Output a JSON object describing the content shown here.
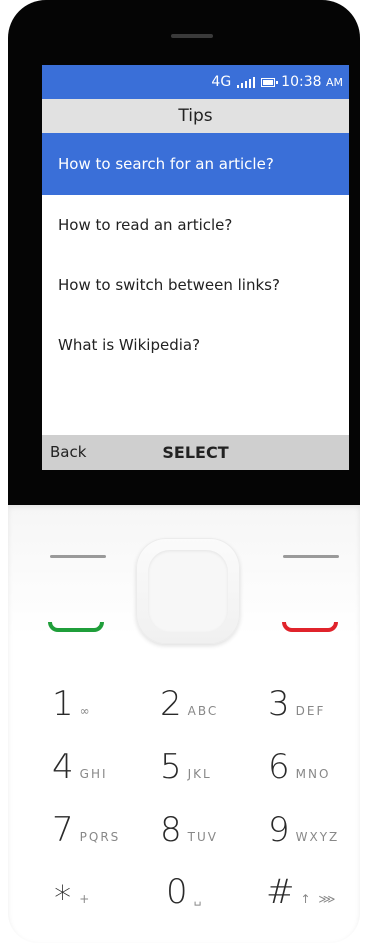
{
  "status": {
    "network": "4G",
    "time": "10:38",
    "ampm": "AM"
  },
  "screen": {
    "title": "Tips",
    "items": [
      {
        "label": "How to search for an article?",
        "selected": true
      },
      {
        "label": "How to read an article?",
        "selected": false
      },
      {
        "label": "How to switch between links?",
        "selected": false
      },
      {
        "label": "What is Wikipedia?",
        "selected": false
      }
    ],
    "softkeys": {
      "left": "Back",
      "center": "SELECT"
    }
  },
  "keypad": [
    {
      "digit": "1",
      "letters": "∞"
    },
    {
      "digit": "2",
      "letters": "ABC"
    },
    {
      "digit": "3",
      "letters": "DEF"
    },
    {
      "digit": "4",
      "letters": "GHI"
    },
    {
      "digit": "5",
      "letters": "JKL"
    },
    {
      "digit": "6",
      "letters": "MNO"
    },
    {
      "digit": "7",
      "letters": "PQRS"
    },
    {
      "digit": "8",
      "letters": "TUV"
    },
    {
      "digit": "9",
      "letters": "WXYZ"
    },
    {
      "digit": "∗",
      "letters": "+"
    },
    {
      "digit": "0",
      "letters": "␣"
    },
    {
      "digit": "#",
      "letters": "↑ ⋙"
    }
  ],
  "colors": {
    "accent": "#3a6fd8",
    "call": "#1f9e3a",
    "end": "#e0232b"
  }
}
